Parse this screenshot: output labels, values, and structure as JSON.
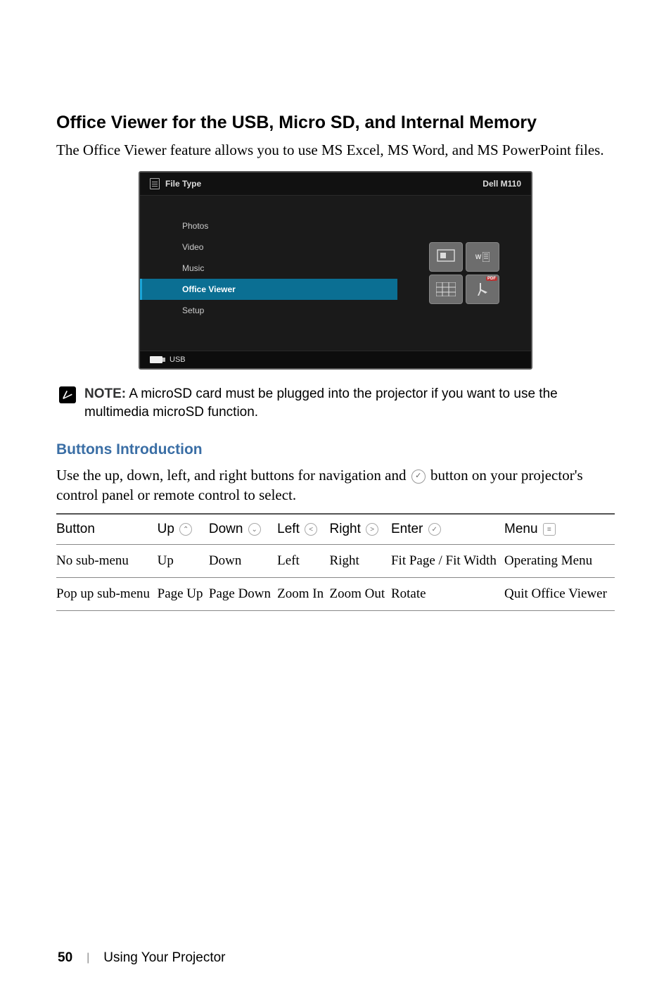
{
  "section_title": "Office Viewer for the USB, Micro SD, and Internal Memory",
  "intro": "The Office Viewer feature allows you to use MS Excel, MS Word, and MS PowerPoint files.",
  "screenshot": {
    "header_left": "File Type",
    "header_right": "Dell M110",
    "menu": [
      "Photos",
      "Video",
      "Music",
      "Office Viewer",
      "Setup"
    ],
    "active_index": 3,
    "thumb_pdf_label": "PDF",
    "thumb_w_label": "W",
    "footer_label": "USB"
  },
  "note_label": "NOTE:",
  "note_text": " A microSD card must be plugged into the projector if you want to use the multimedia microSD function.",
  "sub_heading": "Buttons Introduction",
  "sub_intro_a": "Use the up, down, left, and right buttons for navigation and ",
  "sub_intro_b": " button on your projector's control panel or remote control to select.",
  "table": {
    "headers": {
      "button": "Button",
      "up": "Up",
      "down": "Down",
      "left": "Left",
      "right": "Right",
      "enter": "Enter",
      "menu": "Menu"
    },
    "rows": [
      {
        "button": "No sub-menu",
        "up": "Up",
        "down": "Down",
        "left": "Left",
        "right": "Right",
        "enter": "Fit Page / Fit Width",
        "menu": "Operating Menu"
      },
      {
        "button": "Pop up sub-menu",
        "up": "Page Up",
        "down": "Page Down",
        "left": "Zoom In",
        "right": "Zoom Out",
        "enter": "Rotate",
        "menu": "Quit Office Viewer"
      }
    ]
  },
  "footer": {
    "page_number": "50",
    "section_label": "Using Your Projector"
  }
}
